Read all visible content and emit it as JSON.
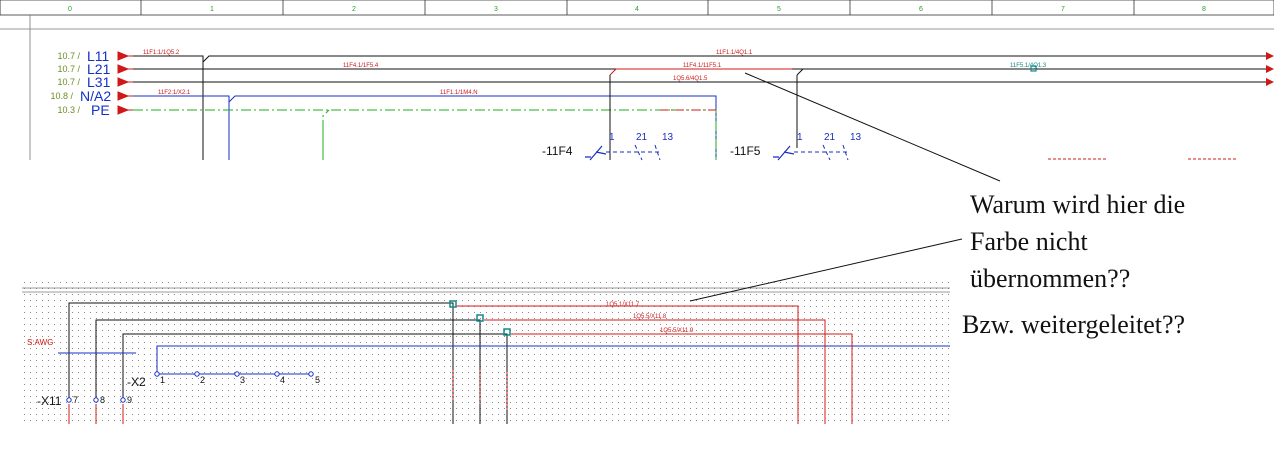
{
  "ruler": {
    "columns": [
      "0",
      "1",
      "2",
      "3",
      "4",
      "5",
      "6",
      "7",
      "8"
    ]
  },
  "buses": [
    {
      "ref": "10.7 /",
      "name": "L11"
    },
    {
      "ref": "10.7 /",
      "name": "L21"
    },
    {
      "ref": "10.7 /",
      "name": "L31"
    },
    {
      "ref": "10.8 /",
      "name": "N/A2"
    },
    {
      "ref": "10.3 /",
      "name": "PE"
    }
  ],
  "wire_labels_top": [
    "11F1:1/1Q5.2",
    "11F1.1/4Q1.1",
    "11F4.1/1F5.4",
    "11F4.1/11F5.1",
    "11F5.1/4Q1.3",
    "1Q5.6/4Q1.5",
    "11F2:1/X2.1",
    "11F1.1/1M4.N"
  ],
  "devices": [
    {
      "name": "-11F4",
      "pins": [
        "1",
        "21",
        "13"
      ]
    },
    {
      "name": "-11F5",
      "pins": [
        "1",
        "21",
        "13"
      ]
    }
  ],
  "bottom": {
    "awg_label": "S:AWG",
    "terminal_x2": "-X2",
    "terminal_x11": "-X11",
    "x2_pins": [
      "1",
      "2",
      "3",
      "4",
      "5"
    ],
    "x11_pins": [
      "7",
      "8",
      "9"
    ],
    "wire_labels": [
      "1Q5.1/X11.7",
      "1Q5.5/X11.8",
      "1Q5.5/X11.9"
    ]
  },
  "annotations": {
    "question_lines": [
      "Warum wird hier die",
      "Farbe nicht",
      "übernommen??"
    ],
    "followup": "Bzw. weitergeleitet??"
  },
  "colors": {
    "bus_blue": "#1530c8",
    "wire_red": "#d01818",
    "pe_green": "#19b019",
    "terminal_teal": "#138a8a"
  }
}
